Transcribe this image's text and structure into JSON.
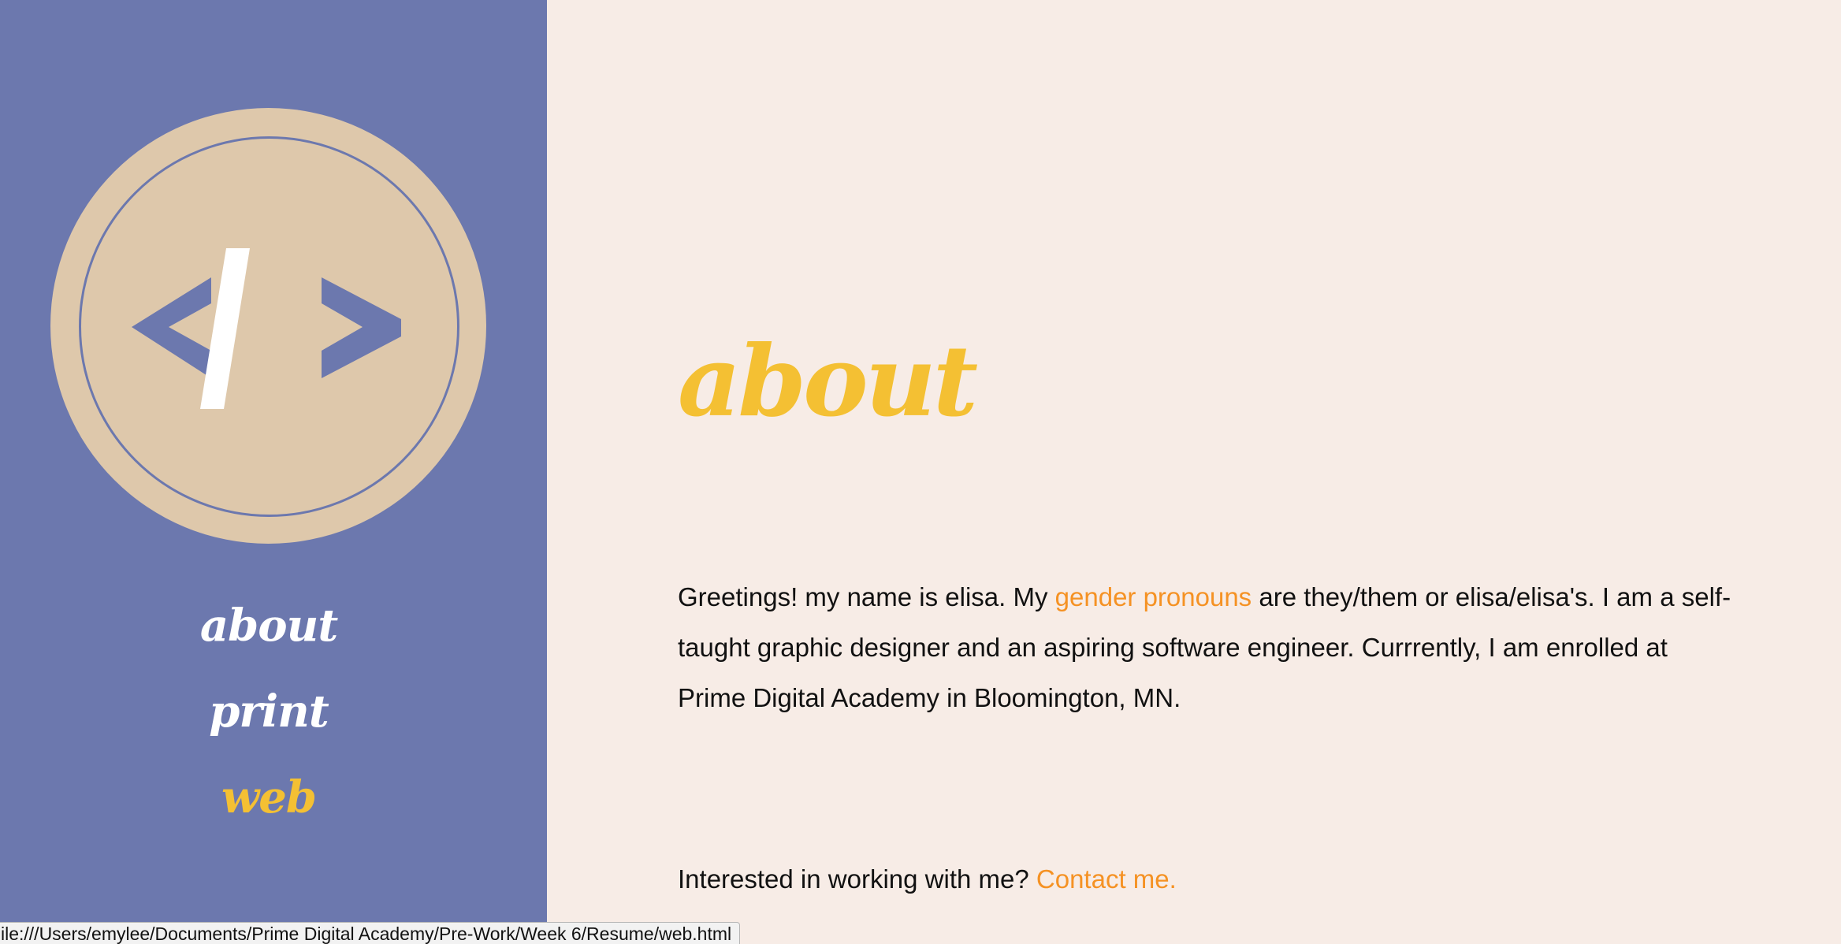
{
  "sidebar": {
    "logo_icon": "code-brackets-icon",
    "nav": [
      {
        "label": "about"
      },
      {
        "label": "print"
      },
      {
        "label": "web",
        "active": true
      }
    ]
  },
  "main": {
    "heading": "about",
    "intro": {
      "text_before": "Greetings! my name is elisa. My ",
      "link_label": "gender pronouns",
      "text_after": " are they/them or elisa/elisa's. I am a self-taught graphic designer and an aspiring software engineer. Currrently, I am enrolled at Prime Digital Academy in Bloomington, MN."
    },
    "cta": {
      "text": "Interested in working with me? ",
      "link_label": "Contact me."
    }
  },
  "status_bar": {
    "url": "ile:///Users/emylee/Documents/Prime Digital Academy/Pre-Work/Week 6/Resume/web.html"
  },
  "colors": {
    "sidebar_bg": "#6c78ae",
    "page_bg": "#f7ece6",
    "logo_bg": "#dec8ab",
    "accent_yellow": "#f4c033",
    "link_orange": "#f59224"
  }
}
